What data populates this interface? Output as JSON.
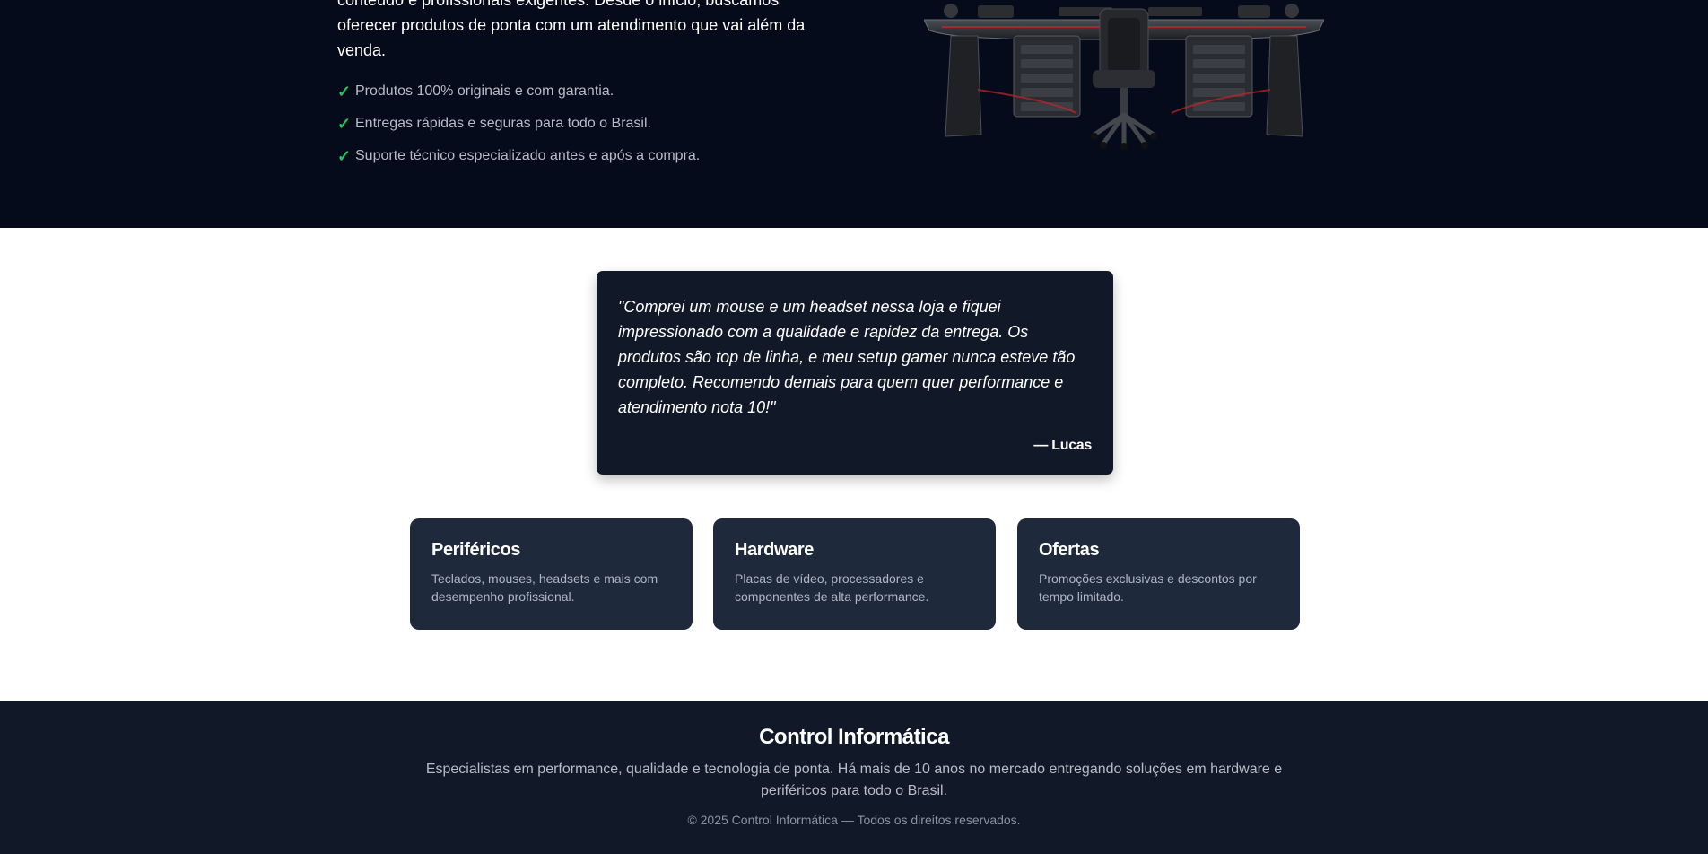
{
  "hero": {
    "intro_line1": "conteúdo e profissionais exigentes. Desde o início, buscamos",
    "intro_line2": "oferecer produtos de ponta com um atendimento que vai além da",
    "intro_line3": "venda.",
    "check_icon": "check-icon",
    "check_color": "#22c55e",
    "checklist": [
      "Produtos 100% originais e com garantia.",
      "Entregas rápidas e seguras para todo o Brasil.",
      "Suporte técnico especializado antes e após a compra."
    ]
  },
  "testimonial": {
    "quote": "\"Comprei um mouse e um headset nessa loja e fiquei impressionado com a qualidade e rapidez da entrega. Os produtos são top de linha, e meu setup gamer nunca esteve tão completo. Recomendo demais para quem quer performance e atendimento nota 10!\"",
    "author": "— Lucas"
  },
  "categories": [
    {
      "title": "Periféricos",
      "description": "Teclados, mouses, headsets e mais com desempenho profissional."
    },
    {
      "title": "Hardware",
      "description": "Placas de vídeo, processadores e componentes de alta performance."
    },
    {
      "title": "Ofertas",
      "description": "Promoções exclusivas e descontos por tempo limitado."
    }
  ],
  "footer": {
    "brand": "Control Informática",
    "about": "Especialistas em performance, qualidade e tecnologia de ponta. Há mais de 10 anos no mercado entregando soluções em hardware e periféricos para todo o Brasil.",
    "copyright": "© 2025 Control Informática — Todos os direitos reservados."
  },
  "colors": {
    "hero_bg": "#050b1a",
    "card_bg": "#1e293b",
    "footer_bg": "#111827",
    "accent_green": "#22c55e"
  }
}
